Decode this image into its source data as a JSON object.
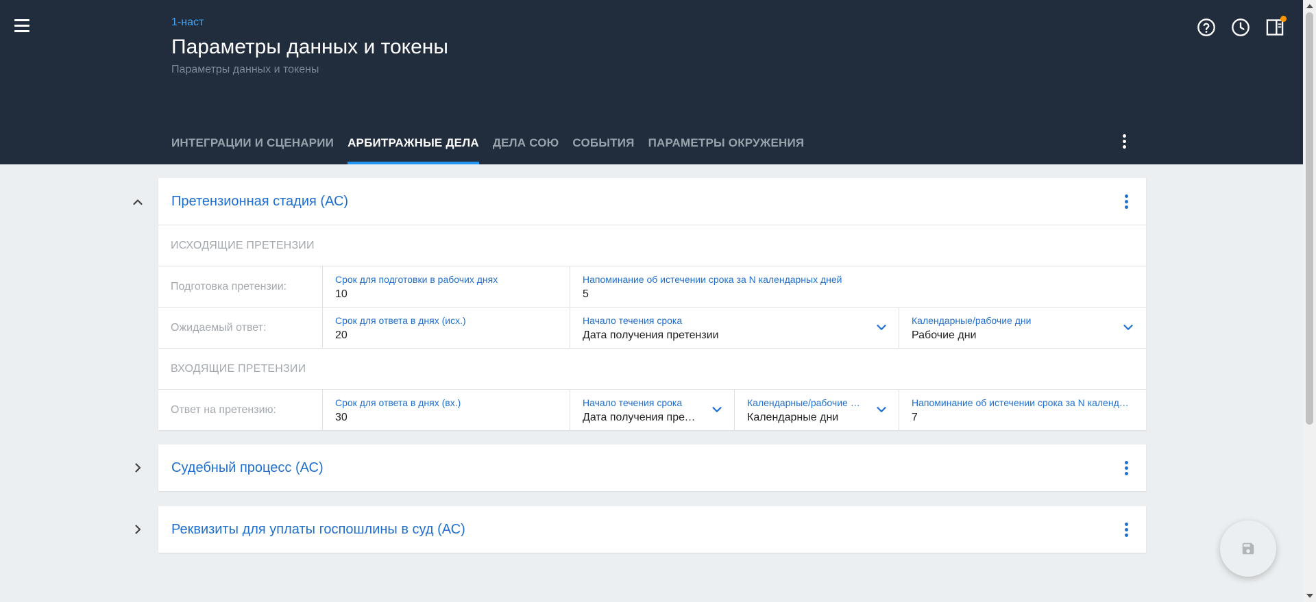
{
  "header": {
    "breadcrumb": "1-наст",
    "title": "Параметры данных и токены",
    "subtitle": "Параметры данных и токены",
    "icons": [
      "menu-icon",
      "help-icon",
      "history-icon",
      "panel-icon"
    ],
    "notification_color": "#ff9800"
  },
  "tabs": [
    {
      "label": "ИНТЕГРАЦИИ И СЦЕНАРИИ",
      "active": false
    },
    {
      "label": "АРБИТРАЖНЫЕ ДЕЛА",
      "active": true
    },
    {
      "label": "ДЕЛА СОЮ",
      "active": false
    },
    {
      "label": "СОБЫТИЯ",
      "active": false
    },
    {
      "label": "ПАРАМЕТРЫ ОКРУЖЕНИЯ",
      "active": false
    }
  ],
  "colors": {
    "header_bg": "#212d3d",
    "accent": "#1e6fd0",
    "tab_indicator": "#2196f3",
    "page_bg": "#eceff1"
  },
  "panels": {
    "claim": {
      "title": "Претензионная стадия (АС)",
      "expanded": true,
      "outgoing": {
        "section_label": "ИСХОДЯЩИЕ ПРЕТЕНЗИИ",
        "prep": {
          "label": "Подготовка претензии:",
          "deadline_label": "Срок для подготовки в рабочих днях",
          "deadline_value": "10",
          "reminder_label": "Напоминание об истечении срока за N календарных дней",
          "reminder_value": "5"
        },
        "expected": {
          "label": "Ожидаемый ответ:",
          "deadline_label": "Срок для ответа в днях (исх.)",
          "deadline_value": "20",
          "start_label": "Начало течения срока",
          "start_value": "Дата получения претензии",
          "days_label": "Календарные/рабочие дни",
          "days_value": "Рабочие дни"
        }
      },
      "incoming": {
        "section_label": "ВХОДЯЩИЕ ПРЕТЕНЗИИ",
        "answer": {
          "label": "Ответ на претензию:",
          "deadline_label": "Срок для ответа в днях (вх.)",
          "deadline_value": "30",
          "start_label": "Начало течения срока",
          "start_value": "Дата получения претензии",
          "days_label": "Календарные/рабочие дни",
          "days_value": "Календарные дни",
          "reminder_label": "Напоминание об истечении срока за N календарных дней",
          "reminder_value": "7"
        }
      }
    },
    "court": {
      "title": "Судебный процесс (АС)",
      "expanded": false
    },
    "fee": {
      "title": "Реквизиты для уплаты госпошлины в суд (АС)",
      "expanded": false
    }
  },
  "fab": {
    "icon": "save-icon"
  }
}
